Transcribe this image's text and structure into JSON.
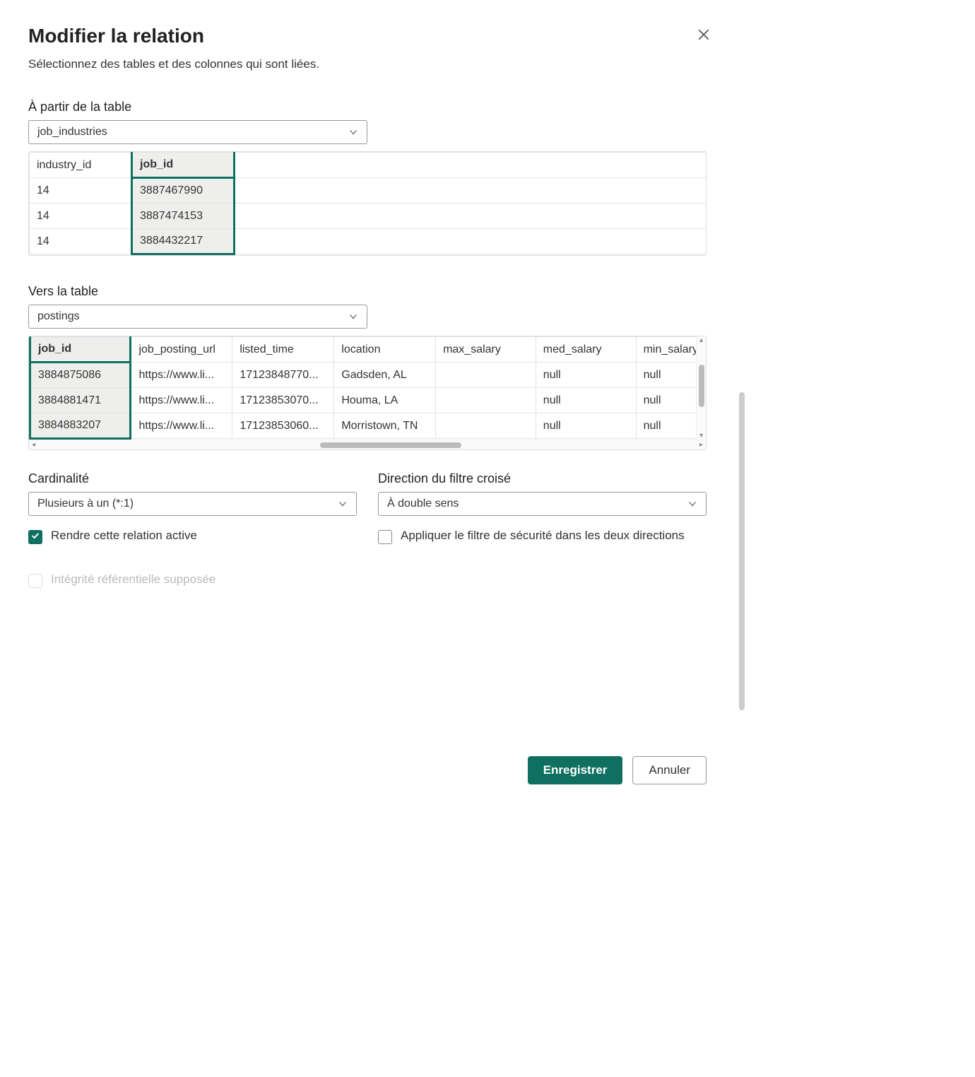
{
  "dialog": {
    "title": "Modifier la relation",
    "subtitle": "Sélectionnez des tables et des colonnes qui sont liées."
  },
  "from_table": {
    "label": "À partir de la table",
    "selected": "job_industries",
    "selected_column": "job_id",
    "columns": [
      "industry_id",
      "job_id"
    ],
    "rows": [
      {
        "industry_id": "14",
        "job_id": "3887467990"
      },
      {
        "industry_id": "14",
        "job_id": "3887474153"
      },
      {
        "industry_id": "14",
        "job_id": "3884432217"
      }
    ]
  },
  "to_table": {
    "label": "Vers la table",
    "selected": "postings",
    "selected_column": "job_id",
    "columns": [
      "job_id",
      "job_posting_url",
      "listed_time",
      "location",
      "max_salary",
      "med_salary",
      "min_salary"
    ],
    "rows": [
      {
        "job_id": "3884875086",
        "job_posting_url": "https://www.li...",
        "listed_time": "17123848770...",
        "location": "Gadsden, AL",
        "max_salary": "",
        "med_salary": "null",
        "min_salary": "null"
      },
      {
        "job_id": "3884881471",
        "job_posting_url": "https://www.li...",
        "listed_time": "17123853070...",
        "location": "Houma, LA",
        "max_salary": "",
        "med_salary": "null",
        "min_salary": "null"
      },
      {
        "job_id": "3884883207",
        "job_posting_url": "https://www.li...",
        "listed_time": "17123853060...",
        "location": "Morristown, TN",
        "max_salary": "",
        "med_salary": "null",
        "min_salary": "null"
      }
    ]
  },
  "cardinality": {
    "label": "Cardinalité",
    "selected": "Plusieurs à un (*:1)"
  },
  "cross_filter": {
    "label": "Direction du filtre croisé",
    "selected": "À double sens"
  },
  "checks": {
    "active": {
      "label": "Rendre cette relation active",
      "checked": true
    },
    "security_both": {
      "label": "Appliquer le filtre de sécurité dans les deux directions",
      "checked": false
    },
    "referential": {
      "label": "Intégrité référentielle supposée",
      "checked": false,
      "disabled": true
    }
  },
  "buttons": {
    "save": "Enregistrer",
    "cancel": "Annuler"
  }
}
